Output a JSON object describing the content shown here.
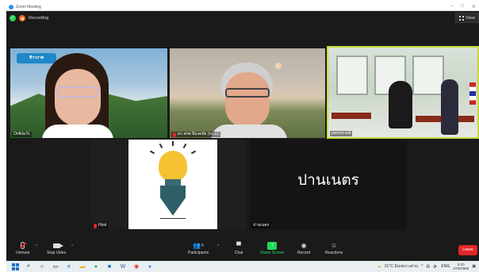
{
  "window": {
    "title": "Zoom Meeting"
  },
  "status": {
    "recording_label": "Recording",
    "view_label": "View"
  },
  "tiles": [
    {
      "name": "Onfida N."
    },
    {
      "name": "ดร.พรพ มีมงคลัย (ทร.ม)"
    },
    {
      "name": "pannet suk"
    },
    {
      "name": "Host"
    },
    {
      "name": "ปานเนตร",
      "display_text": "ปานเนตร"
    }
  ],
  "logo_badge": "ชีวาภาพ",
  "toolbar": {
    "unmute": "Unmute",
    "stop_video": "Stop Video",
    "participants": "Participants",
    "participants_count": "5",
    "chat": "Chat",
    "share_screen": "Share Screen",
    "record": "Record",
    "reactions": "Reactions",
    "leave": "Leave"
  },
  "taskbar": {
    "weather": "31°C มีเมฆบางส่วน",
    "lang": "ENG",
    "time": "9:20",
    "date": "27/5/2565"
  },
  "colors": {
    "accent_green": "#23d959",
    "leave_red": "#e02828",
    "active_speaker": "#c8d83a"
  }
}
